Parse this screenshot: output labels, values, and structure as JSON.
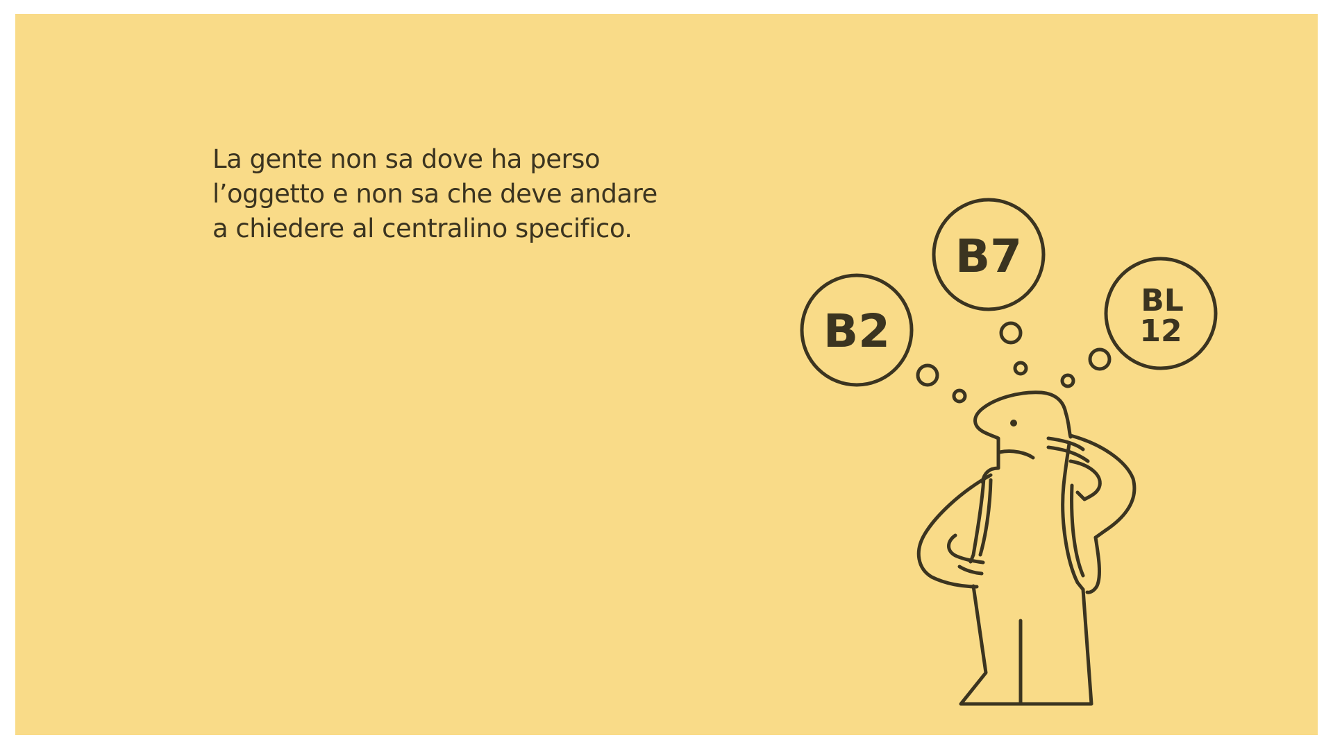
{
  "caption": {
    "line1": "La gente non sa dove ha perso",
    "line2": "l’oggetto e non sa che deve andare",
    "line3": "a chiedere al centralino specifico."
  },
  "thought_bubbles": [
    {
      "label": "B2"
    },
    {
      "label": "B7"
    },
    {
      "label_line1": "BL",
      "label_line2": "12"
    }
  ],
  "colors": {
    "background": "#f9db88",
    "ink": "#3b3420"
  },
  "illustration_icon": "confused-person-icon"
}
